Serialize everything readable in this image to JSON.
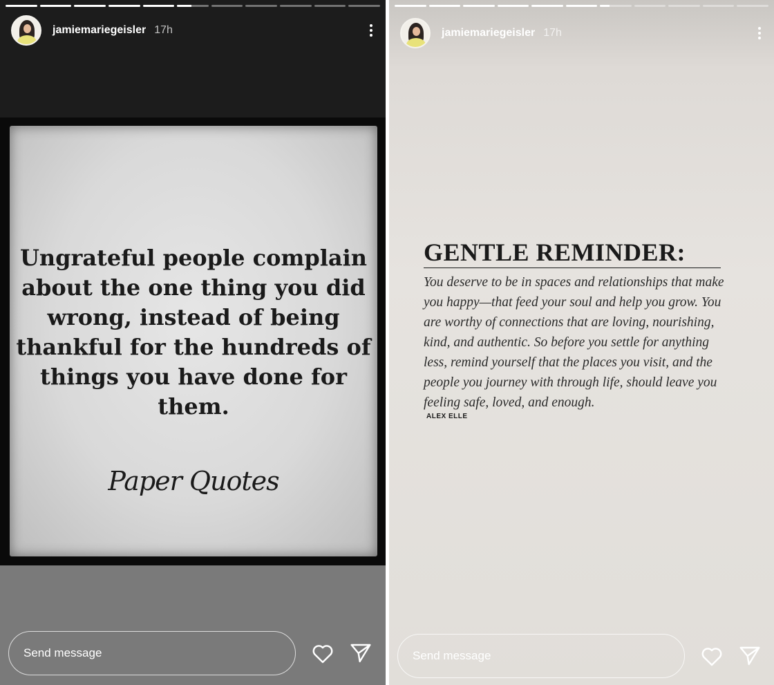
{
  "stories": [
    {
      "username": "jamiemariegeisler",
      "time": "17h",
      "progress": {
        "total": 11,
        "completed": 5,
        "current_fraction": 0.45
      },
      "content": {
        "quote": "Ungrateful people complain about the one thing you did wrong, instead of being thankful for the hundreds of things you have done for them.",
        "signature": "Paper Quotes"
      },
      "reply_placeholder": "Send message"
    },
    {
      "username": "jamiemariegeisler",
      "time": "17h",
      "progress": {
        "total": 11,
        "completed": 6,
        "current_fraction": 0.3
      },
      "content": {
        "title": "GENTLE REMINDER:",
        "body": "You deserve to be in spaces and relationships that make you happy—that feed your soul and help you grow. You are worthy of connections that are loving, nourishing, kind, and authentic. So before you settle for anything less, remind yourself that the places you visit, and the people you journey with through life, should leave you feeling safe, loved, and enough.",
        "author": "ALEX ELLE"
      },
      "reply_placeholder": "Send message"
    }
  ],
  "icons": {
    "more": "more-vertical-icon",
    "like": "heart-icon",
    "share": "send-icon"
  },
  "colors": {
    "left_background": "#1e1e1e",
    "right_background": "#e4e1dd",
    "progress_fill": "#ffffff"
  }
}
